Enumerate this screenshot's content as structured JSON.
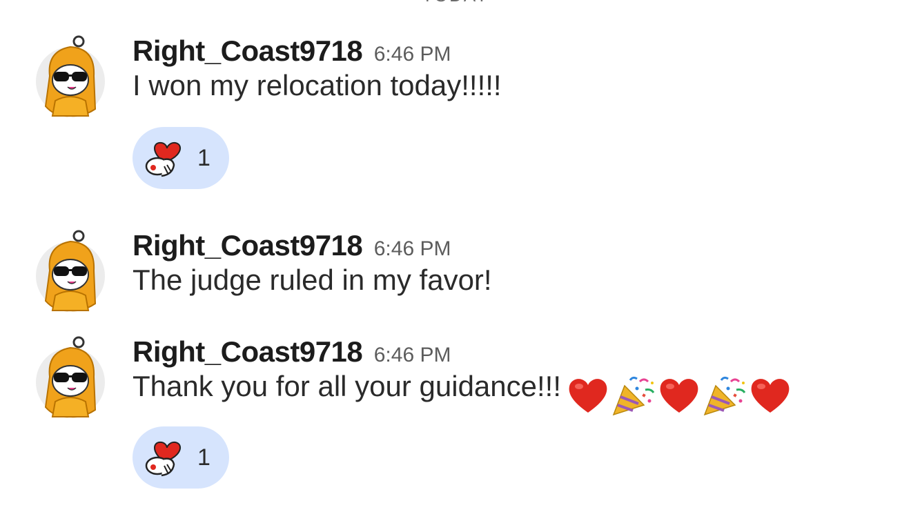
{
  "day_divider": "TODAY",
  "messages": [
    {
      "username": "Right_Coast9718",
      "time": "6:46 PM",
      "text": "I won my relocation today!!!!!",
      "reaction": {
        "icon": "snoo-heart-reaction-icon",
        "count": "1"
      }
    },
    {
      "username": "Right_Coast9718",
      "time": "6:46 PM",
      "text": "The judge ruled in my favor!"
    },
    {
      "username": "Right_Coast9718",
      "time": "6:46 PM",
      "text": "Thank you for all your guidance!!!",
      "emojis": [
        "red-heart-icon",
        "party-popper-icon",
        "red-heart-icon",
        "party-popper-icon",
        "red-heart-icon"
      ],
      "reaction": {
        "icon": "snoo-heart-reaction-icon",
        "count": "1"
      }
    }
  ],
  "colors": {
    "reaction_bg": "#d6e4fd",
    "avatar_hair": "#f0a21b",
    "heart": "#e0281f"
  }
}
